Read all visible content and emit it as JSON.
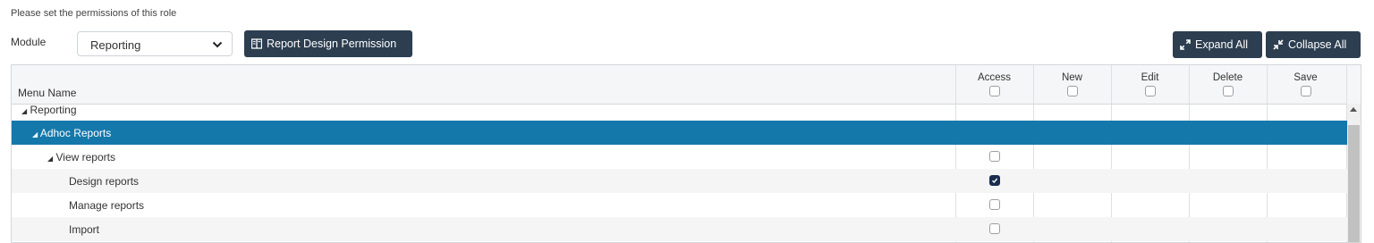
{
  "intro_text": "Please set the permissions of this role",
  "module": {
    "label": "Module",
    "selected": "Reporting"
  },
  "buttons": {
    "design": "Report Design Permission",
    "expand": "Expand All",
    "collapse": "Collapse All"
  },
  "grid": {
    "menu_header": "Menu Name",
    "columns": [
      "Access",
      "New",
      "Edit",
      "Delete",
      "Save"
    ],
    "rows": [
      {
        "label": "Reporting",
        "indent": 1,
        "expanded": true,
        "access": null
      },
      {
        "label": "Adhoc Reports",
        "indent": 2,
        "expanded": true,
        "selected": true,
        "access": null
      },
      {
        "label": "View reports",
        "indent": 3,
        "expanded": true,
        "access": false
      },
      {
        "label": "Design reports",
        "indent": 4,
        "access": true
      },
      {
        "label": "Manage reports",
        "indent": 4,
        "access": false
      },
      {
        "label": "Import",
        "indent": 4,
        "access": false
      }
    ]
  },
  "colors": {
    "selected_row": "#1478ab",
    "dark_button": "#2c3e50",
    "header_bg": "#f5f6f7"
  }
}
